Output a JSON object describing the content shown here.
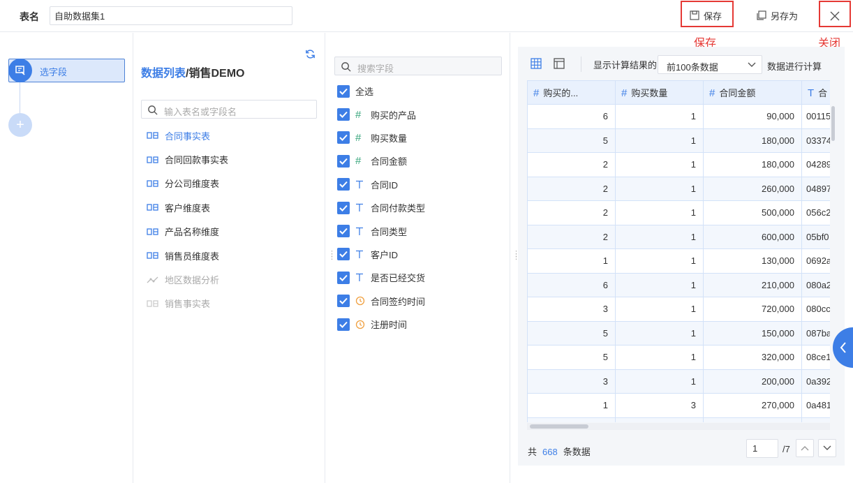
{
  "header": {
    "table_name_label": "表名",
    "table_name_value": "自助数据集1",
    "save_label": "保存",
    "save_as_label": "另存为",
    "annotation_save": "保存",
    "annotation_close": "关闭"
  },
  "steps": {
    "active_label": "选字段",
    "add_label": "+"
  },
  "tables_panel": {
    "breadcrumb_link": "数据列表",
    "breadcrumb_sep": "/",
    "breadcrumb_current": "销售DEMO",
    "search_placeholder": "输入表名或字段名",
    "items": [
      {
        "label": "合同事实表",
        "state": "active"
      },
      {
        "label": "合同回款事实表",
        "state": "normal"
      },
      {
        "label": "分公司维度表",
        "state": "normal"
      },
      {
        "label": "客户维度表",
        "state": "normal"
      },
      {
        "label": "产品名称维度",
        "state": "normal"
      },
      {
        "label": "销售员维度表",
        "state": "normal"
      },
      {
        "label": "地区数据分析",
        "state": "disabled"
      },
      {
        "label": "销售事实表",
        "state": "disabled"
      }
    ]
  },
  "fields_panel": {
    "search_placeholder": "搜索字段",
    "select_all_label": "全选",
    "fields": [
      {
        "label": "购买的产品",
        "type": "number",
        "checked": true
      },
      {
        "label": "购买数量",
        "type": "number",
        "checked": true
      },
      {
        "label": "合同金额",
        "type": "number",
        "checked": true
      },
      {
        "label": "合同ID",
        "type": "text",
        "checked": true
      },
      {
        "label": "合同付款类型",
        "type": "text",
        "checked": true
      },
      {
        "label": "合同类型",
        "type": "text",
        "checked": true
      },
      {
        "label": "客户ID",
        "type": "text",
        "checked": true
      },
      {
        "label": "是否已经交货",
        "type": "text",
        "checked": true
      },
      {
        "label": "合同签约时间",
        "type": "date",
        "checked": true
      },
      {
        "label": "注册时间",
        "type": "date",
        "checked": true
      }
    ]
  },
  "preview": {
    "toolbar_text_prefix": "显示计算结果的",
    "select_value": "前100条数据",
    "toolbar_text_suffix": "数据进行计算",
    "columns": [
      {
        "label": "购买的...",
        "type": "number"
      },
      {
        "label": "购买数量",
        "type": "number"
      },
      {
        "label": "合同金额",
        "type": "number"
      },
      {
        "label": "合",
        "type": "text"
      }
    ],
    "rows": [
      [
        "6",
        "1",
        "90,000",
        "00115"
      ],
      [
        "5",
        "1",
        "180,000",
        "03374"
      ],
      [
        "2",
        "1",
        "180,000",
        "04289"
      ],
      [
        "2",
        "1",
        "260,000",
        "04897"
      ],
      [
        "2",
        "1",
        "500,000",
        "056c2"
      ],
      [
        "2",
        "1",
        "600,000",
        "05bf0"
      ],
      [
        "1",
        "1",
        "130,000",
        "0692a"
      ],
      [
        "6",
        "1",
        "210,000",
        "080a2"
      ],
      [
        "3",
        "1",
        "720,000",
        "080cc"
      ],
      [
        "5",
        "1",
        "150,000",
        "087ba"
      ],
      [
        "5",
        "1",
        "320,000",
        "08ce1"
      ],
      [
        "3",
        "1",
        "200,000",
        "0a392"
      ],
      [
        "1",
        "3",
        "270,000",
        "0a481"
      ],
      [
        "",
        "",
        "",
        ""
      ]
    ],
    "footer": {
      "total_prefix": "共",
      "total_count": "668",
      "total_suffix": "条数据",
      "page_value": "1",
      "page_total": "/7"
    }
  }
}
